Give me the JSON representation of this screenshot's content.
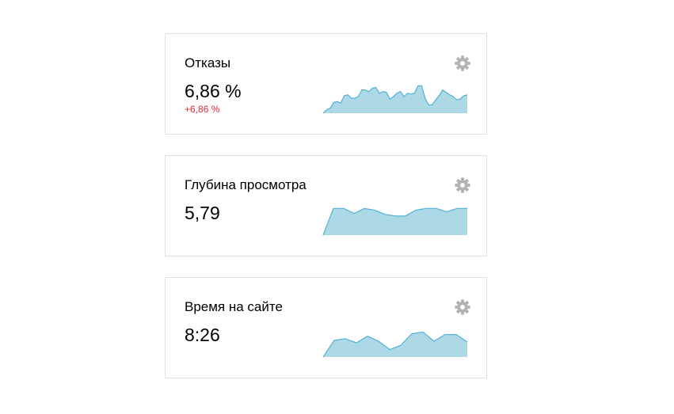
{
  "colors": {
    "chart_fill": "#add8e6",
    "chart_line": "#5ab4d6",
    "delta_negative": "#e0282f",
    "gear": "#b3b3b3"
  },
  "widgets": [
    {
      "title": "Отказы",
      "value": "6,86 %",
      "delta": "+6,86 %",
      "icon": "gear-icon",
      "chart_data": {
        "type": "area",
        "values": [
          0,
          4,
          6,
          13,
          14,
          12,
          21,
          22,
          18,
          18,
          20,
          28,
          28,
          26,
          30,
          31,
          24,
          26,
          25,
          17,
          20,
          24,
          26,
          20,
          24,
          23,
          24,
          33,
          33,
          18,
          10,
          10,
          16,
          21,
          28,
          25,
          22,
          20,
          16,
          17,
          21,
          22
        ],
        "ylim": [
          0,
          40
        ]
      }
    },
    {
      "title": "Глубина просмотра",
      "value": "5,79",
      "icon": "gear-icon",
      "chart_data": {
        "type": "area",
        "values": [
          0,
          32,
          32,
          26,
          32,
          30,
          25,
          23,
          23,
          30,
          32,
          32,
          28,
          32,
          32
        ],
        "ylim": [
          0,
          40
        ]
      }
    },
    {
      "title": "Время на сайте",
      "value": "8:26",
      "icon": "gear-icon",
      "chart_data": {
        "type": "area",
        "values": [
          0,
          20,
          22,
          17,
          25,
          19,
          9,
          14,
          28,
          30,
          19,
          27,
          27,
          18
        ],
        "ylim": [
          0,
          40
        ]
      }
    }
  ]
}
